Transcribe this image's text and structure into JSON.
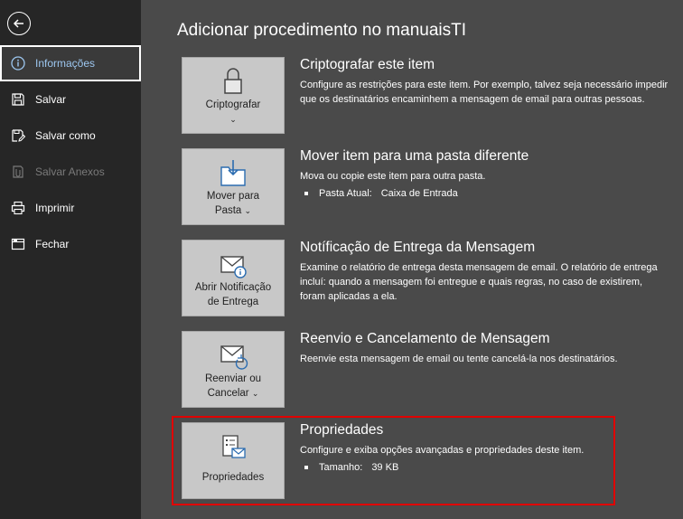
{
  "colors": {
    "sidebar_bg": "#262626",
    "main_bg": "#4a4a4a",
    "button_bg": "#c8c8c8",
    "active_text": "#9dc7f0",
    "highlight_border": "#e00000"
  },
  "sidebar": {
    "back_icon": "back-arrow-icon",
    "items": [
      {
        "label": "Informações",
        "icon": "info-icon",
        "active": true
      },
      {
        "label": "Salvar",
        "icon": "save-icon"
      },
      {
        "label": "Salvar como",
        "icon": "save-as-icon"
      },
      {
        "label": "Salvar Anexos",
        "icon": "save-attachments-icon",
        "disabled": true
      },
      {
        "label": "Imprimir",
        "icon": "print-icon"
      },
      {
        "label": "Fechar",
        "icon": "close-folder-icon"
      }
    ]
  },
  "main": {
    "title": "Adicionar procedimento no manuaisTI",
    "sections": [
      {
        "button_lines": [
          "Criptografar",
          ""
        ],
        "icon": "lock-icon",
        "title": "Criptografar este item",
        "description": "Configure as restrições para este item. Por exemplo, talvez seja necessário impedir que os destinatários encaminhem a mensagem de email para outras pessoas."
      },
      {
        "button_lines": [
          "Mover para",
          "Pasta"
        ],
        "icon": "move-to-folder-icon",
        "title": "Mover item para uma pasta diferente",
        "description": "Mova ou copie este item para outra pasta.",
        "detail_label": "Pasta Atual:",
        "detail_value": "Caixa de Entrada"
      },
      {
        "button_lines": [
          "Abrir Notificação",
          "de Entrega"
        ],
        "icon": "delivery-report-icon",
        "title": "Notíficação de Entrega da Mensagem",
        "description": "Examine o relatório de entrega desta mensagem de email. O relatório de entrega incluí: quando a mensagem foi entregue e quais regras, no caso de existirem, foram aplicadas a ela."
      },
      {
        "button_lines": [
          "Reenviar ou",
          "Cancelar"
        ],
        "icon": "resend-icon",
        "title": "Reenvio e Cancelamento de Mensagem",
        "description": "Reenvie esta mensagem de email ou tente cancelá-la nos destinatários."
      },
      {
        "button_lines": [
          "Propriedades",
          ""
        ],
        "icon": "properties-icon",
        "title": "Propriedades",
        "description": "Configure e exiba opções avançadas e propriedades deste item.",
        "detail_label": "Tamanho:",
        "detail_value": "39 KB"
      }
    ]
  }
}
